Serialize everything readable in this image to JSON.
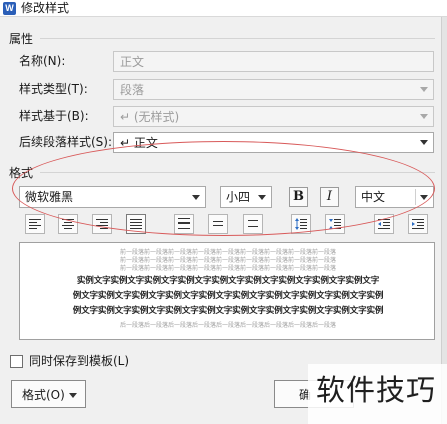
{
  "window": {
    "title": "修改样式",
    "icon": "w-app-icon"
  },
  "properties": {
    "section_label": "属性",
    "name": {
      "label": "名称(N):",
      "value": "正文"
    },
    "style_type": {
      "label": "样式类型(T):",
      "value": "段落"
    },
    "based_on": {
      "label": "样式基于(B):",
      "value": "↵ (无样式)"
    },
    "next_style": {
      "label": "后续段落样式(S):",
      "value": "↵ 正文"
    }
  },
  "format": {
    "section_label": "格式",
    "font_name": "微软雅黑",
    "font_size": "小四",
    "bold": "B",
    "italic": "I",
    "language": "中文",
    "paragraph_icons": [
      "align-left-icon",
      "align-center-icon",
      "align-right-icon",
      "align-justify-icon",
      "align-distributed-icon",
      "line-spacing-single-icon",
      "line-spacing-1-5-icon",
      "line-spacing-double-icon",
      "space-before-increase-icon",
      "space-before-decrease-icon",
      "indent-decrease-icon",
      "indent-increase-icon"
    ]
  },
  "preview": {
    "prev_line": "前一段落前一段落前一段落前一段落前一段落前一段落前一段落前一段落前一段落",
    "sample_line": "实例文字实例文字实例文字实例文字实例文字实例文字实例文字实例文字实例文字",
    "sample_line_2": "例文字实例文字实例文字实例文字实例文字实例文字实例文字实例文字实例文字实例",
    "next_line": "后一段落后一段落后一段落后一段落后一段落后一段落后一段落后一段落后一段落"
  },
  "footer": {
    "save_to_template": "同时保存到模板(L)",
    "format_button": "格式(O)",
    "ok_button": "确"
  },
  "watermark": "软件技巧",
  "colors": {
    "annotation_ellipse": "#d85a5a",
    "app_icon": "#2b5fb8"
  }
}
